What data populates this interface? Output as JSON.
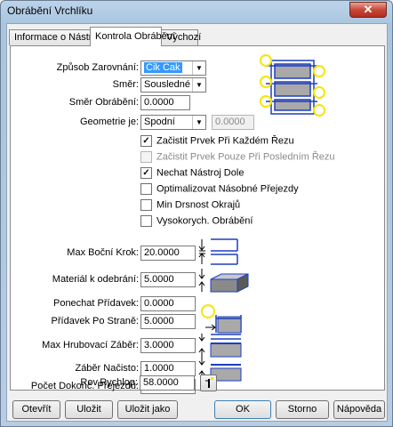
{
  "window": {
    "title": "Obrábění Vrchlíku",
    "close_glyph": "✕"
  },
  "tabs": [
    {
      "label": "Informace o Nástroji",
      "active": false
    },
    {
      "label": "Kontrola Obrábění",
      "active": true
    },
    {
      "label": "Výchozí",
      "active": false
    }
  ],
  "form": {
    "zpusob_zarovnani": {
      "label": "Způsob Zarovnání:",
      "value": "Cik Cak"
    },
    "smer": {
      "label": "Směr:",
      "value": "Sousledné"
    },
    "smer_obrabeni": {
      "label": "Směr Obrábění:",
      "value": "0.0000"
    },
    "geometrie": {
      "label": "Geometrie je:",
      "value": "Spodní",
      "extra_value": "0.0000"
    },
    "checkboxes": [
      {
        "label": "Začistit Prvek Při Každém Řezu",
        "checked": true,
        "enabled": true
      },
      {
        "label": "Začistit Prvek Pouze Při Posledním Řezu",
        "checked": false,
        "enabled": false
      },
      {
        "label": "Nechat Nástroj Dole",
        "checked": true,
        "enabled": true
      },
      {
        "label": "Optimalizovat Násobné Přejezdy",
        "checked": false,
        "enabled": true
      },
      {
        "label": "Min Drsnost Okrajů",
        "checked": false,
        "enabled": true
      },
      {
        "label": "Vysokorych. Obrábění",
        "checked": false,
        "enabled": true
      }
    ],
    "max_bocni_krok": {
      "label": "Max Boční Krok:",
      "value": "20.0000"
    },
    "material_k_odebrani": {
      "label": "Materiál k odebrání:",
      "value": "5.0000"
    },
    "ponechat_pridavek": {
      "label": "Ponechat Přídavek:",
      "value": "0.0000"
    },
    "pridavek_po_strane": {
      "label": "Přídavek Po Straně:",
      "value": "5.0000"
    },
    "max_hrubovaci_zaber": {
      "label": "Max Hrubovací Záběr:",
      "value": "3.0000"
    },
    "zaber_nacisto": {
      "label": "Záběr Načisto:",
      "value": "1.0000"
    },
    "pocet_dokonc_prejezdu": {
      "label": "Počet Dokonč. Přejezdů:",
      "value": "1"
    },
    "rov_rychlop": {
      "label": "Rov.Rychlop:",
      "value": "58.0000"
    }
  },
  "buttons": {
    "otevrit": "Otevřít",
    "ulozit": "Uložit",
    "ulozit_jako": "Uložit jako",
    "ok": "OK",
    "storno": "Storno",
    "napoveda": "Nápověda"
  },
  "colors": {
    "accent_blue": "#1f3fbf",
    "highlight_yellow": "#f5e600",
    "selection": "#3399ff"
  }
}
